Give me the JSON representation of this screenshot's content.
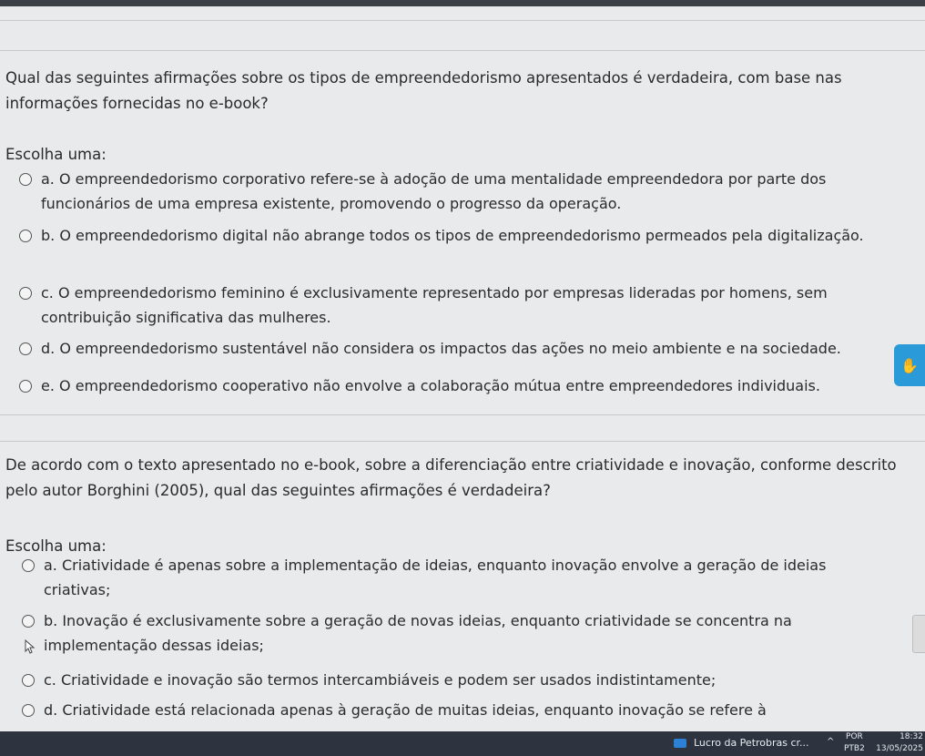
{
  "questions": [
    {
      "text": "Qual das seguintes afirmações sobre os tipos de empreendedorismo apresentados é verdadeira, com base nas informações fornecidas no e-book?",
      "choose_label": "Escolha uma:",
      "options": [
        "a. O empreendedorismo corporativo refere-se à adoção de uma mentalidade empreendedora por parte dos funcionários de uma empresa existente, promovendo o progresso da operação.",
        "b. O empreendedorismo digital não abrange todos os tipos de empreendedorismo permeados pela digitalização.",
        "c. O empreendedorismo feminino é exclusivamente representado por empresas lideradas por homens, sem contribuição significativa das mulheres.",
        "d. O empreendedorismo sustentável não considera os impactos das ações no meio ambiente e na sociedade.",
        "e. O empreendedorismo cooperativo não envolve a colaboração mútua entre empreendedores individuais."
      ]
    },
    {
      "text": "De acordo com o texto apresentado no e-book, sobre a diferenciação entre criatividade e inovação, conforme descrito pelo autor Borghini (2005), qual das seguintes afirmações é verdadeira?",
      "choose_label": "Escolha uma:",
      "options": [
        "a. Criatividade é apenas sobre a implementação de ideias, enquanto inovação envolve a geração de ideias criativas;",
        "b. Inovação é exclusivamente sobre a geração de novas ideias, enquanto criatividade se concentra na implementação dessas ideias;",
        "c. Criatividade e inovação são termos intercambiáveis e podem ser usados indistintamente;",
        "d. Criatividade está relacionada apenas à geração de muitas ideias, enquanto inovação se refere à"
      ]
    }
  ],
  "side_widget": {
    "icon": "sign-language-hands-icon",
    "color": "#2a9bd8"
  },
  "taskbar": {
    "app_label": "Lucro da Petrobras cr...",
    "chevron": "^",
    "lang_top": "POR",
    "lang_bottom": "PTB2",
    "time": "18:32",
    "date": "13/05/2025"
  }
}
